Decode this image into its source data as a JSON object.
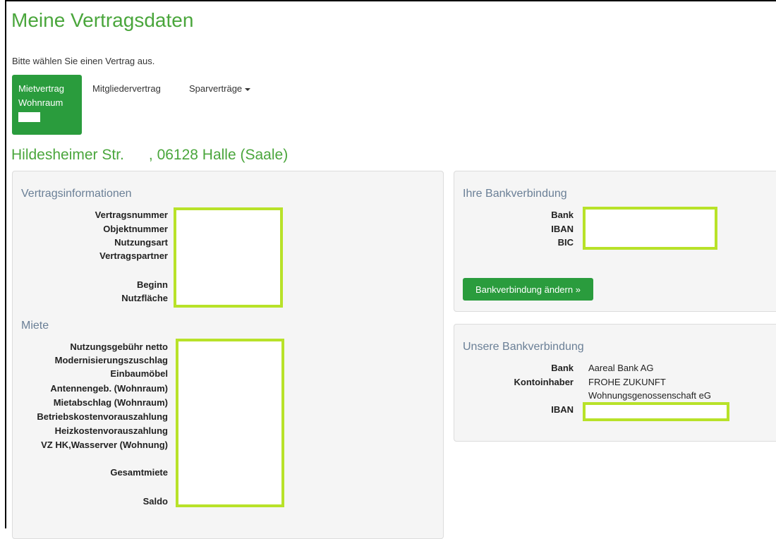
{
  "page": {
    "title": "Meine Vertragsdaten",
    "intro": "Bitte wählen Sie einen Vertrag aus."
  },
  "tabs": [
    {
      "line1": "Mietvertrag",
      "line2": "Wohnraum",
      "active": true
    },
    {
      "label": "Mitgliedervertrag",
      "active": false
    },
    {
      "label": "Sparverträge",
      "active": false,
      "has_dropdown": true
    }
  ],
  "address": "Hildesheimer Str.      , 06128 Halle (Saale)",
  "contract_info": {
    "title": "Vertragsinformationen",
    "labels": [
      "Vertragsnummer",
      "Objektnummer",
      "Nutzungsart",
      "Vertragspartner",
      "Beginn",
      "Nutzfläche"
    ]
  },
  "rent": {
    "title": "Miete",
    "labels": [
      "Nutzungsgebühr netto",
      "Modernisierungszuschlag",
      "Einbaumöbel",
      "Antennengeb. (Wohnraum)",
      "Mietabschlag (Wohnraum)",
      "Betriebskostenvorauszahlung",
      "Heizkostenvorauszahlung",
      "VZ HK,Wasserver (Wohnung)",
      "Gesamtmiete",
      "Saldo"
    ]
  },
  "your_bank": {
    "title": "Ihre Bankverbindung",
    "labels": [
      "Bank",
      "IBAN",
      "BIC"
    ],
    "button": "Bankverbindung ändern »"
  },
  "our_bank": {
    "title": "Unsere Bankverbindung",
    "bank_label": "Bank",
    "bank_value": "Aareal Bank AG",
    "holder_label": "Kontoinhaber",
    "holder_line1": "FROHE ZUKUNFT",
    "holder_line2": "Wohnungsgenossenschaft eG",
    "iban_label": "IBAN"
  },
  "colors": {
    "brand_green": "#4aa63c",
    "button_green": "#2a9c3d",
    "redaction_outline": "#b8e229"
  }
}
